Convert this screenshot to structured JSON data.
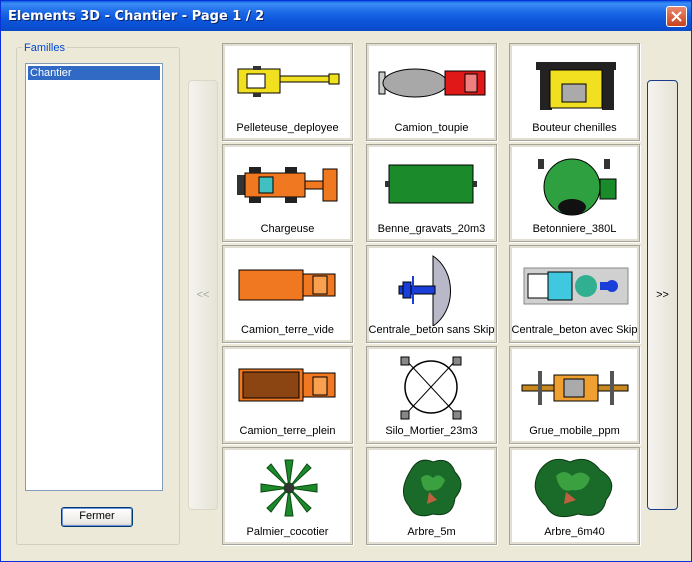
{
  "window": {
    "title": "Elements 3D - Chantier - Page 1 / 2"
  },
  "familles": {
    "legend": "Familles",
    "items": [
      "Chantier"
    ],
    "selected": "Chantier"
  },
  "buttons": {
    "close": "Fermer",
    "prev": "<<",
    "next": ">>"
  },
  "grid": [
    {
      "name": "Pelleteuse_deployee",
      "icon": "excavator-icon"
    },
    {
      "name": "Camion_toupie",
      "icon": "concrete-mixer-truck-icon"
    },
    {
      "name": "Bouteur chenilles",
      "icon": "bulldozer-icon"
    },
    {
      "name": "Chargeuse",
      "icon": "loader-icon"
    },
    {
      "name": "Benne_gravats_20m3",
      "icon": "debris-skip-icon"
    },
    {
      "name": "Betonniere_380L",
      "icon": "cement-mixer-icon"
    },
    {
      "name": "Camion_terre_vide",
      "icon": "empty-dump-truck-icon"
    },
    {
      "name": "Centrale_beton sans Skip",
      "icon": "concrete-plant-icon"
    },
    {
      "name": "Centrale_beton avec Skip",
      "icon": "concrete-plant-skip-icon"
    },
    {
      "name": "Camion_terre_plein",
      "icon": "full-dump-truck-icon"
    },
    {
      "name": "Silo_Mortier_23m3",
      "icon": "mortar-silo-icon"
    },
    {
      "name": "Grue_mobile_ppm",
      "icon": "mobile-crane-icon"
    },
    {
      "name": "Palmier_cocotier",
      "icon": "palm-tree-icon"
    },
    {
      "name": "Arbre_5m",
      "icon": "tree-icon"
    },
    {
      "name": "Arbre_6m40",
      "icon": "tree-large-icon"
    }
  ]
}
